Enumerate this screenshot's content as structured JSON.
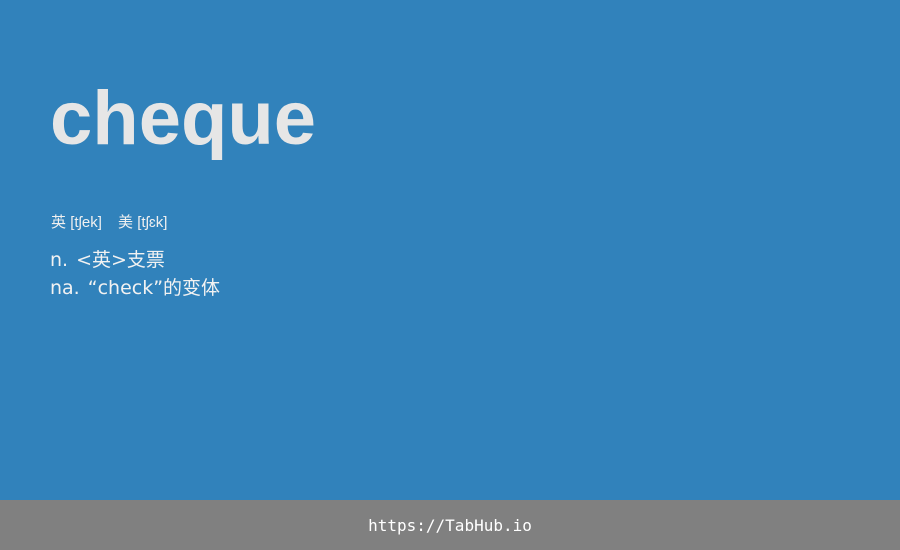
{
  "card": {
    "word": "cheque",
    "phonetics": {
      "uk_label": "英",
      "uk": "[tʃek]",
      "us_label": "美",
      "us": "[tʃɛk]"
    },
    "definitions": [
      {
        "pos": "n.",
        "meaning": "<英>支票"
      },
      {
        "pos": "na.",
        "meaning": "“check”的变体"
      }
    ]
  },
  "footer": {
    "link_text": "https://TabHub.io"
  },
  "colors": {
    "background": "#3182bb",
    "word": "#e6e6e6",
    "footer_bg": "#808080"
  }
}
